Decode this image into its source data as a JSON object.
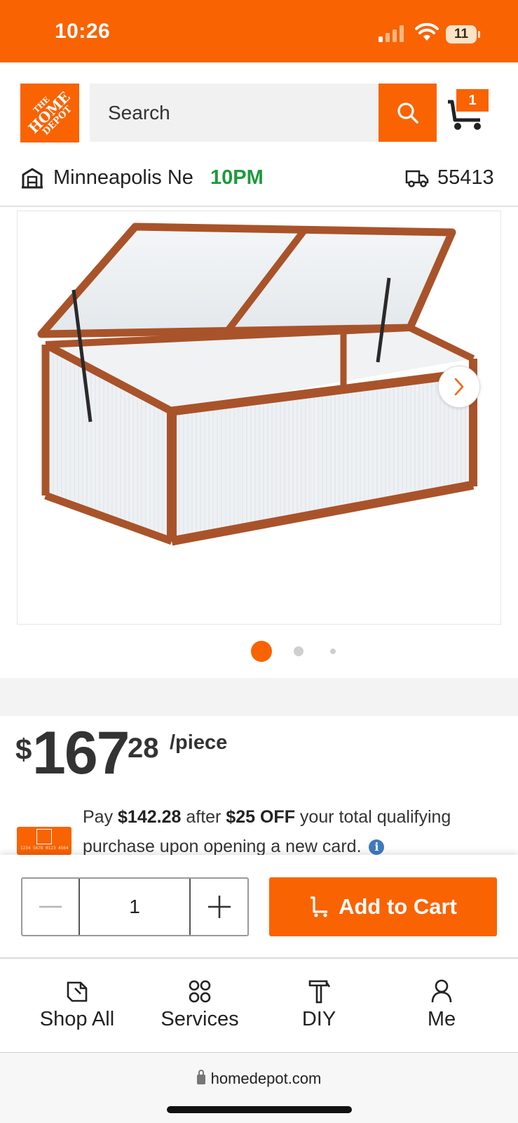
{
  "status_bar": {
    "time": "10:26",
    "battery": "11"
  },
  "header": {
    "logo": {
      "line1": "THE",
      "line2": "HOME",
      "line3": "DEPOT"
    },
    "search_placeholder": "Search",
    "cart_count": "1",
    "store_name": "Minneapolis Ne",
    "store_hours": "10PM",
    "zip": "55413"
  },
  "gallery": {
    "active_index": 1,
    "image_count": 3
  },
  "price": {
    "dollar_sign": "$",
    "dollars": "167",
    "cents": "28",
    "unit": "/piece"
  },
  "promo": {
    "text_1": "Pay ",
    "amount": "$142.28",
    "text_2": " after ",
    "discount": "$25 OFF",
    "text_3": " your total qualifying purchase upon opening a new card.",
    "card_number": "1234 5678 0123 4564"
  },
  "buy_bar": {
    "quantity": "1",
    "add_to_cart_label": "Add to Cart"
  },
  "bottom_nav": {
    "items": [
      {
        "label": "Shop All",
        "icon": "shop-all-icon"
      },
      {
        "label": "Services",
        "icon": "services-icon"
      },
      {
        "label": "DIY",
        "icon": "diy-icon"
      },
      {
        "label": "Me",
        "icon": "me-icon"
      }
    ]
  },
  "browser": {
    "url": "homedepot.com"
  },
  "colors": {
    "brand_orange": "#f96302",
    "store_hours_green": "#1d9a3b",
    "info_blue": "#3e7bbd"
  }
}
